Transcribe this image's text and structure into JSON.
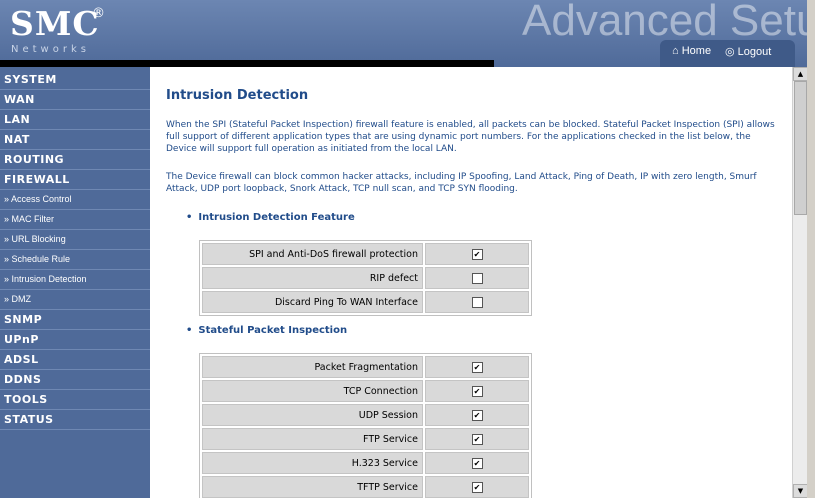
{
  "header": {
    "logo": "SMC",
    "logo_reg": "®",
    "logo_sub": "Networks",
    "title": "Advanced Setup",
    "home": "Home",
    "logout": "Logout",
    "home_icon": "house-icon",
    "logout_icon": "circle-icon",
    "colors": {
      "header_bg": "#5873a3",
      "sidebar_bg": "#4f6a99",
      "title_text": "#214c8a"
    }
  },
  "sidebar": {
    "items": [
      {
        "label": "SYSTEM"
      },
      {
        "label": "WAN"
      },
      {
        "label": "LAN"
      },
      {
        "label": "NAT"
      },
      {
        "label": "ROUTING"
      },
      {
        "label": "FIREWALL"
      },
      {
        "label": "» Access Control"
      },
      {
        "label": "» MAC Filter"
      },
      {
        "label": "» URL Blocking"
      },
      {
        "label": "» Schedule Rule"
      },
      {
        "label": "» Intrusion Detection"
      },
      {
        "label": "» DMZ"
      },
      {
        "label": "SNMP"
      },
      {
        "label": "UPnP"
      },
      {
        "label": "ADSL"
      },
      {
        "label": "DDNS"
      },
      {
        "label": "TOOLS"
      },
      {
        "label": "STATUS"
      }
    ]
  },
  "main": {
    "title": "Intrusion Detection",
    "para1": "When the SPI (Stateful Packet Inspection) firewall feature is enabled, all packets can be blocked.  Stateful Packet Inspection (SPI) allows full support of different application types that are using dynamic port numbers.  For the applications checked in the list below, the Device will support full operation as initiated from the local LAN.",
    "para2": "The Device firewall can block common hacker attacks, including IP Spoofing, Land Attack, Ping of Death, IP with zero length, Smurf Attack, UDP port loopback, Snork Attack, TCP null scan, and TCP SYN flooding.",
    "section1": {
      "title": "Intrusion Detection Feature",
      "rows": [
        {
          "label": "SPI and Anti-DoS firewall protection",
          "checked": "✔"
        },
        {
          "label": "RIP defect",
          "checked": ""
        },
        {
          "label": "Discard Ping To WAN Interface",
          "checked": ""
        }
      ]
    },
    "section2": {
      "title": "Stateful Packet Inspection",
      "rows": [
        {
          "label": "Packet Fragmentation",
          "checked": "✔"
        },
        {
          "label": "TCP Connection",
          "checked": "✔"
        },
        {
          "label": "UDP Session",
          "checked": "✔"
        },
        {
          "label": "FTP Service",
          "checked": "✔"
        },
        {
          "label": "H.323 Service",
          "checked": "✔"
        },
        {
          "label": "TFTP  Service",
          "checked": "✔"
        }
      ]
    }
  },
  "scrollbar": {
    "up": "▲",
    "down": "▼"
  }
}
